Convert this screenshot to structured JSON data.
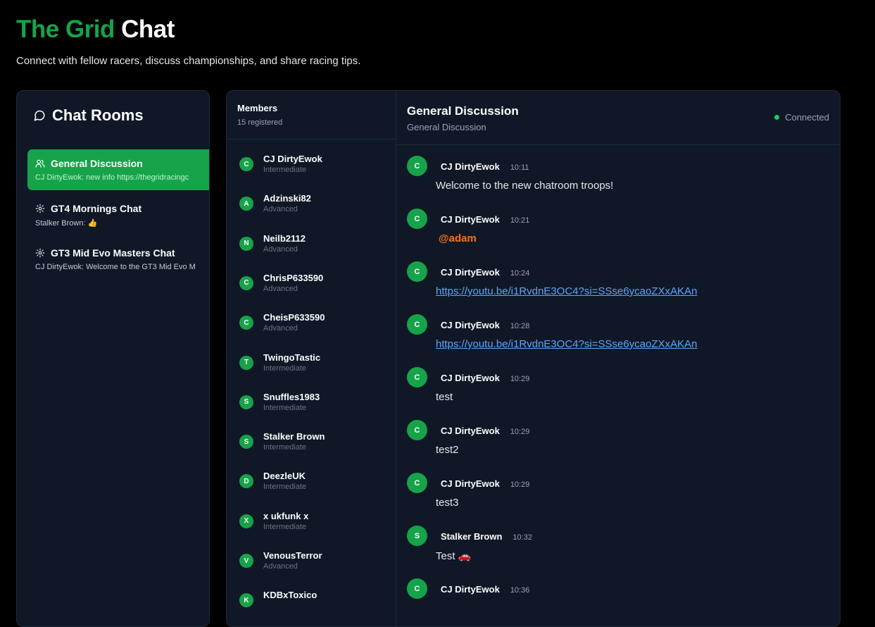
{
  "header": {
    "title_accent": "The Grid",
    "title_rest": "Chat",
    "subtitle": "Connect with fellow racers, discuss championships, and share racing tips."
  },
  "colors": {
    "accent": "#16a34a",
    "panel": "#101827",
    "link": "#60a5fa",
    "mention": "#f97316"
  },
  "rooms": {
    "title": "Chat Rooms",
    "items": [
      {
        "icon": "users-icon",
        "name": "General Discussion",
        "preview": "CJ DirtyEwok: new info https://thegridracingc",
        "active": true
      },
      {
        "icon": "gear-icon",
        "name": "GT4 Mornings Chat",
        "preview": "Stalker Brown: 👍",
        "active": false
      },
      {
        "icon": "gear-icon",
        "name": "GT3 Mid Evo Masters Chat",
        "preview": "CJ DirtyEwok: Welcome to the GT3 Mid Evo M",
        "active": false
      }
    ]
  },
  "members": {
    "title": "Members",
    "count": "15 registered",
    "items": [
      {
        "initial": "C",
        "name": "CJ DirtyEwok",
        "level": "Intermediate"
      },
      {
        "initial": "A",
        "name": "Adzinski82",
        "level": "Advanced"
      },
      {
        "initial": "N",
        "name": "Neilb2112",
        "level": "Advanced"
      },
      {
        "initial": "C",
        "name": "ChrisP633590",
        "level": "Advanced"
      },
      {
        "initial": "C",
        "name": "CheisP633590",
        "level": "Advanced"
      },
      {
        "initial": "T",
        "name": "TwingoTastic",
        "level": "Intermediate"
      },
      {
        "initial": "S",
        "name": "Snuffles1983",
        "level": "Intermediate"
      },
      {
        "initial": "S",
        "name": "Stalker Brown",
        "level": "Intermediate"
      },
      {
        "initial": "D",
        "name": "DeezleUK",
        "level": "Intermediate"
      },
      {
        "initial": "X",
        "name": "x ukfunk x",
        "level": "Intermediate"
      },
      {
        "initial": "V",
        "name": "VenousTerror",
        "level": "Advanced"
      },
      {
        "initial": "K",
        "name": "KDBxToxico",
        "level": ""
      }
    ]
  },
  "chat": {
    "title": "General Discussion",
    "subtitle": "General Discussion",
    "status": "Connected",
    "messages": [
      {
        "initial": "C",
        "author": "CJ DirtyEwok",
        "time": "10:11",
        "text": "Welcome to the new chatroom troops!",
        "kind": "text"
      },
      {
        "initial": "C",
        "author": "CJ DirtyEwok",
        "time": "10:21",
        "text": "@adam",
        "kind": "mention"
      },
      {
        "initial": "C",
        "author": "CJ DirtyEwok",
        "time": "10:24",
        "text": "https://youtu.be/i1RvdnE3OC4?si=SSse6ycaoZXxAKAn",
        "kind": "link"
      },
      {
        "initial": "C",
        "author": "CJ DirtyEwok",
        "time": "10:28",
        "text": "https://youtu.be/i1RvdnE3OC4?si=SSse6ycaoZXxAKAn",
        "kind": "link"
      },
      {
        "initial": "C",
        "author": "CJ DirtyEwok",
        "time": "10:29",
        "text": "test",
        "kind": "text"
      },
      {
        "initial": "C",
        "author": "CJ DirtyEwok",
        "time": "10:29",
        "text": "test2",
        "kind": "text"
      },
      {
        "initial": "C",
        "author": "CJ DirtyEwok",
        "time": "10:29",
        "text": "test3",
        "kind": "text"
      },
      {
        "initial": "S",
        "author": "Stalker Brown",
        "time": "10:32",
        "text": "Test 🚗",
        "kind": "text"
      },
      {
        "initial": "C",
        "author": "CJ DirtyEwok",
        "time": "10:36",
        "text": "",
        "kind": "link"
      }
    ]
  }
}
